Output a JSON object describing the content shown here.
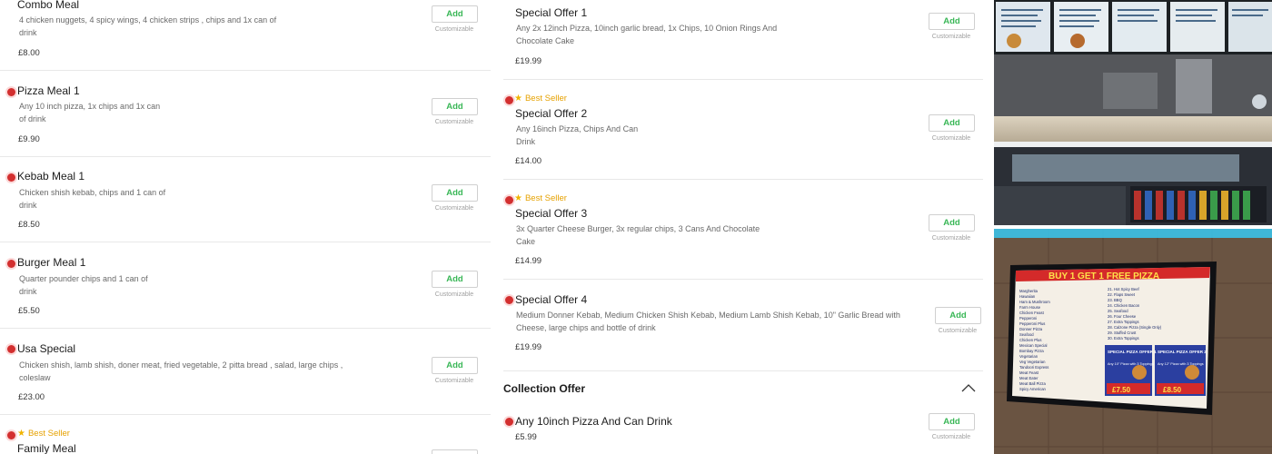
{
  "left_items": [
    {
      "name": "Combo Meal",
      "desc": "4 chicken nuggets, 4 spicy wings, 4 chicken strips , chips and 1x can of drink",
      "price": "£8.00",
      "add_label": "Add",
      "custom_label": "Customizable"
    },
    {
      "name": "Pizza Meal 1",
      "desc": "Any 10 inch pizza, 1x chips and 1x can of drink",
      "price": "£9.90",
      "add_label": "Add",
      "custom_label": "Customizable"
    },
    {
      "name": "Kebab Meal 1",
      "desc": "Chicken shish kebab, chips and 1 can of drink",
      "price": "£8.50",
      "add_label": "Add",
      "custom_label": "Customizable"
    },
    {
      "name": "Burger Meal 1",
      "desc": "Quarter pounder chips and 1 can of drink",
      "price": "£5.50",
      "add_label": "Add",
      "custom_label": "Customizable"
    },
    {
      "name": "Usa Special",
      "desc": "Chicken shish, lamb shish, doner meat, fried vegetable, 2 pitta bread , salad, large chips , coleslaw",
      "price": "£23.00",
      "add_label": "Add",
      "custom_label": "Customizable"
    },
    {
      "badge": "Best Seller",
      "name": "Family Meal"
    }
  ],
  "mid_items": [
    {
      "name": "Special Offer 1",
      "desc": "Any 2x 12inch Pizza, 10inch garlic bread, 1x Chips, 10 Onion Rings And Chocolate Cake",
      "price": "£19.99",
      "add_label": "Add",
      "custom_label": "Customizable"
    },
    {
      "badge": "Best Seller",
      "name": "Special Offer 2",
      "desc": "Any 16inch Pizza, Chips And Can Drink",
      "price": "£14.00",
      "add_label": "Add",
      "custom_label": "Customizable"
    },
    {
      "badge": "Best Seller",
      "name": "Special Offer 3",
      "desc": "3x Quarter Cheese Burger, 3x regular chips, 3 Cans And Chocolate Cake",
      "price": "£14.99",
      "add_label": "Add",
      "custom_label": "Customizable"
    },
    {
      "name": "Special Offer 4",
      "desc": "Medium Donner Kebab, Medium Chicken Shish Kebab, Medium Lamb Shish Kebab, 10\" Garlic Bread with Cheese, large chips and bottle of drink",
      "price": "£19.99",
      "add_label": "Add",
      "custom_label": "Customizable"
    }
  ],
  "collection_section": {
    "title": "Collection Offer",
    "items": [
      {
        "name": "Any 10inch Pizza And Can Drink",
        "price": "£5.99",
        "add_label": "Add",
        "custom_label": "Customizable"
      }
    ]
  },
  "photos": {
    "board_headline": "BUY 1 GET 1 FREE PIZZA",
    "board_offer_1": "SPECIAL PIZZA OFFER 1",
    "board_offer_2": "SPECIAL PIZZA OFFER 2",
    "board_offer_1_text": "Any 10\" Pizza with 3 Toppings",
    "board_offer_2_text": "Any 12\" Pizza with 3 Toppings",
    "board_price_1": "£7.50",
    "board_price_2": "£8.50",
    "board_items": [
      "Margherita",
      "Hawaiian",
      "Ham & Mushroom",
      "Farm House",
      "Chicken Feast",
      "Pepperoni",
      "Pepperoni Plus",
      "Donner Pizza",
      "Seafood",
      "Chicken Plus",
      "Mexican Special",
      "Bombay Pizza",
      "Vegetarian",
      "Veg Vegetarian",
      "Tandoori Express",
      "Meat Feast",
      "Meat Eater",
      "Meat Ball Pizza",
      "Spicy American"
    ],
    "board_items_right": [
      "21. Hot Spicy Beef",
      "22. Flaps Sweet",
      "23. BBQ",
      "24. Chicken Bacon",
      "25. Seafood",
      "26. Four Cheese",
      "27. Extra Toppings",
      "28. Calzone Pizza (Single Only)",
      "29. Stuffed Crust",
      "30. Extra Toppings"
    ]
  }
}
